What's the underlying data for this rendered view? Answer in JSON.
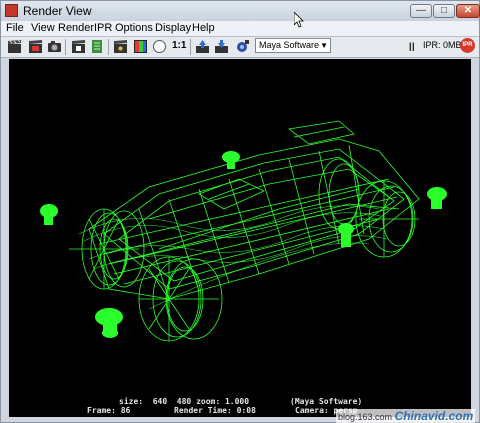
{
  "window": {
    "title": "Render View"
  },
  "menu": [
    "File",
    "View",
    "Render",
    "IPR",
    "Options",
    "Display",
    "Help"
  ],
  "toolbar": {
    "ratio_label": "1:1",
    "renderer": "Maya Software",
    "ipr_status": "IPR: 0MB",
    "ipr_button": "IPR",
    "icons": [
      "clapper-icon",
      "render-region-icon",
      "snapshot-icon",
      "ipr-clapper-icon",
      "refresh-icon",
      "film-clapper-icon",
      "rgb-channels-icon",
      "alpha-channel-icon",
      "keep-image-icon",
      "remove-image-icon",
      "render-settings-icon"
    ]
  },
  "render_info": {
    "size_line": "size:  640  480 zoom: 1.000",
    "renderer_tag": "(Maya Software)",
    "frame": "Frame: 86",
    "render_time": "Render Time: 0:08",
    "camera": "Camera: persp"
  },
  "watermark": {
    "url": "blog.163.com",
    "brand": "Chinavid.com"
  },
  "colors": {
    "wireframe": "#2bff2b",
    "viewport_bg": "#000000"
  }
}
